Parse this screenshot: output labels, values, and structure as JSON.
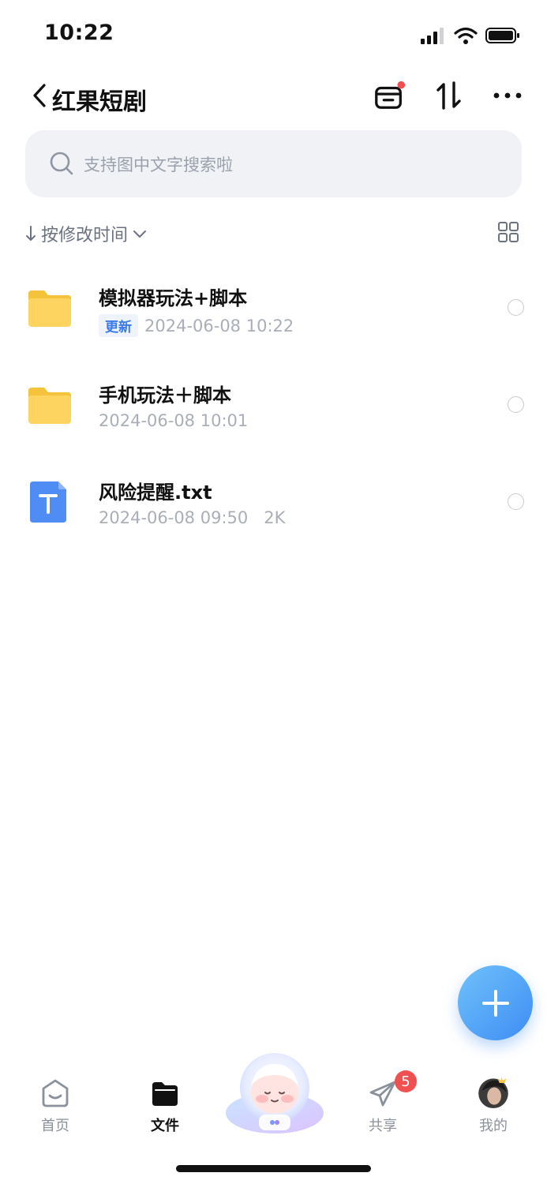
{
  "status_bar": {
    "time": "10:22"
  },
  "header": {
    "title": "红果短剧"
  },
  "search": {
    "placeholder": "支持图中文字搜索啦"
  },
  "sort": {
    "label": "按修改时间"
  },
  "files": [
    {
      "name": "模拟器玩法+脚本",
      "badge": "更新",
      "date": "2024-06-08 10:22",
      "type": "folder"
    },
    {
      "name": "手机玩法＋脚本",
      "date": "2024-06-08 10:01",
      "type": "folder"
    },
    {
      "name": "风险提醒.txt",
      "date": "2024-06-08 09:50",
      "size": "2K",
      "type": "txt"
    }
  ],
  "tabbar": {
    "items": [
      {
        "label": "首页",
        "icon": "home-icon"
      },
      {
        "label": "文件",
        "icon": "folder-icon",
        "active": true
      },
      {
        "label": "",
        "icon": "assistant-mascot"
      },
      {
        "label": "共享",
        "icon": "send-icon",
        "badge": "5"
      },
      {
        "label": "我的",
        "icon": "avatar"
      }
    ]
  },
  "colors": {
    "accent": "#3e8cf4",
    "badge_red": "#f0504f",
    "folder_yellow": "#fdd45f"
  }
}
